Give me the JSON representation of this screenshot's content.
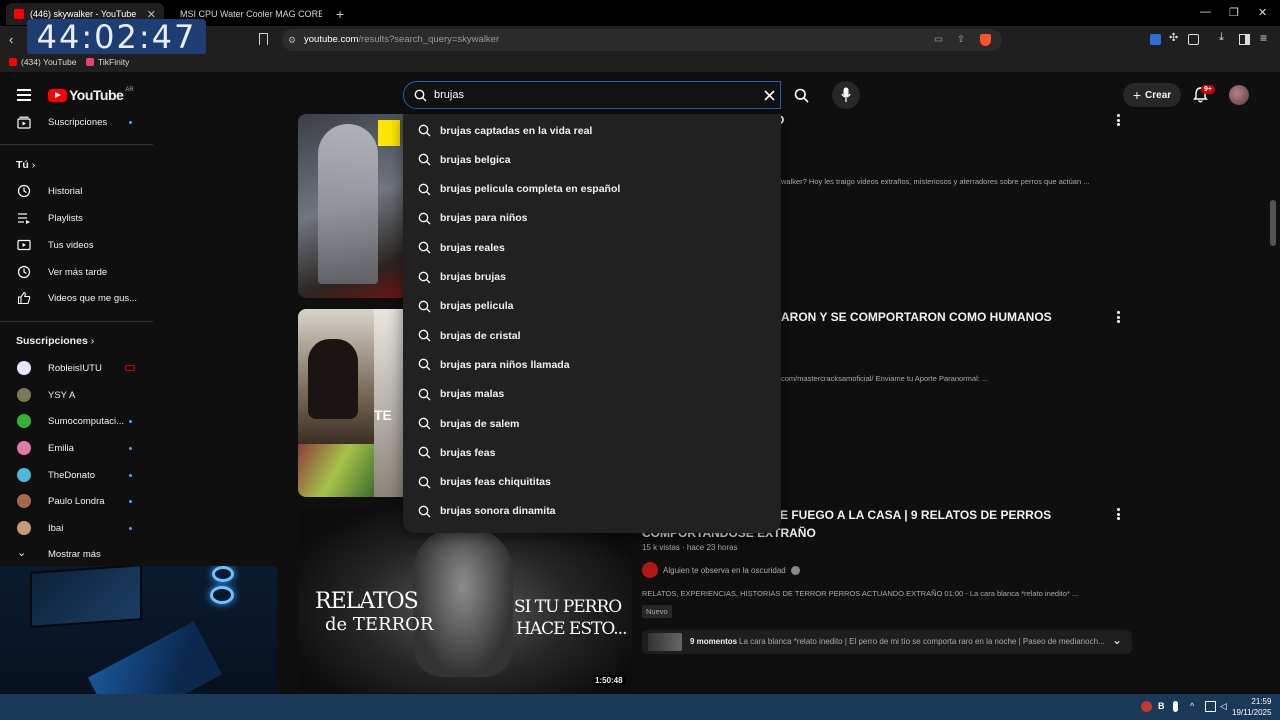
{
  "browser": {
    "tabs": [
      {
        "title": "(446) skywalker - YouTube",
        "active": true
      },
      {
        "title": "MSI CPU Water Cooler MAG CORELIQ",
        "active": false
      }
    ],
    "url_host": "youtube.com",
    "url_path": "/results?search_query=skywalker",
    "bookmarks": [
      "(434) YouTube",
      "TikFinity"
    ],
    "clock_overlay": "44:02:47"
  },
  "header": {
    "logo_text": "YouTube",
    "country": "AR",
    "search_value": "brujas",
    "create_label": "Crear",
    "notif_count": "9+"
  },
  "sidebar": {
    "top_item": "Suscripciones",
    "you_heading": "Tú",
    "you_items": [
      "Historial",
      "Playlists",
      "Tus videos",
      "Ver más tarde",
      "Videos que me gus..."
    ],
    "subs_heading": "Suscripciones",
    "channels": [
      "RobleisIUTU",
      "YSY A",
      "Sumocomputaci...",
      "Emilia",
      "TheDonato",
      "Paulo Londra",
      "Ibai"
    ],
    "show_more": "Mostrar más"
  },
  "suggestions": [
    "brujas captadas en la vida real",
    "brujas belgica",
    "brujas pelicula completa en español",
    "brujas para niños",
    "brujas reales",
    "brujas brujas",
    "brujas pelicula",
    "brujas de cristal",
    "brujas para niños llamada",
    "brujas malas",
    "brujas de salem",
    "brujas feas",
    "brujas feas chiquititas",
    "brujas sonora dinamita"
  ],
  "videos": [
    {
      "title_visible": "O",
      "desc_visible": "walker? Hoy les traigo videos extraños, misteriosos y aterradores sobre perros que actúan ..."
    },
    {
      "title_visible": "ARON Y SE COMPORTARON COMO HUMANOS",
      "desc_visible": "com/mastercracksamoficial/ Enviame tu Aporte Paranormal: ...",
      "thumb_text": "TE"
    },
    {
      "title_line1": "E FUEGO A LA CASA | 9 RELATOS DE PERROS",
      "title_line2": "COMPORTANDOSE EXTRAÑO",
      "views": "15 k vistas",
      "age": "hace 23 horas",
      "channel": "Alguien te observa en la oscuridad",
      "desc": "RELATOS, EXPERIENCIAS, HISTORIAS DE TERROR PERROS ACTUANDO EXTRAÑO 01:00 - La cara blanca *relato inedito* ...",
      "badge": "Nuevo",
      "thumb_left_1": "RELATOS",
      "thumb_left_2": "de TERROR",
      "thumb_right_1": "SI TU PERRO",
      "thumb_right_2": "HACE ESTO...",
      "duration": "1:50:48",
      "moments_label": "9 momentos",
      "moments_text": "La cara blanca *relato inedito | El perro de mi tío se comporta raro en la noche | Paseo de medianoch..."
    }
  ],
  "taskbar": {
    "time": "21:59",
    "date": "19/11/2025"
  },
  "colors": {
    "accent_blue": "#1c62b9",
    "youtube_red": "#ff0000",
    "background": "#0f0f0f",
    "dropdown": "#212121"
  }
}
